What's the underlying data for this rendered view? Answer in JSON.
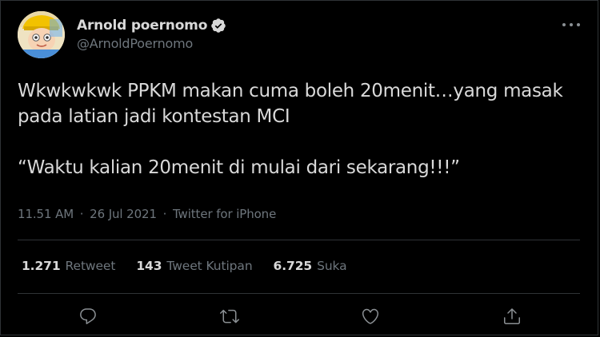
{
  "author": {
    "name": "Arnold poernomo",
    "handle": "@ArnoldPoernomo",
    "verified": true
  },
  "tweet": {
    "text_paragraph_1": "Wkwkwkwk PPKM makan cuma boleh 20menit…yang masak pada latian jadi kontestan MCI",
    "text_paragraph_2": "“Waktu kalian 20menit di mulai dari sekarang!!!”"
  },
  "meta": {
    "time": "11.51 AM",
    "separator": "·",
    "date": "26 Jul 2021",
    "source": "Twitter for iPhone"
  },
  "stats": {
    "retweets": {
      "value": "1.271",
      "label": "Retweet"
    },
    "quotes": {
      "value": "143",
      "label": "Tweet Kutipan"
    },
    "likes": {
      "value": "6.725",
      "label": "Suka"
    }
  },
  "icons": {
    "more": "more-horizontal-icon",
    "reply": "reply-icon",
    "retweet": "retweet-icon",
    "like": "heart-icon",
    "share": "share-icon",
    "verified": "verified-badge-icon"
  },
  "colors": {
    "background": "#000000",
    "text_primary": "#d9d9d9",
    "text_secondary": "#6e767d",
    "divider": "#2f3336",
    "icon": "#8b9094"
  }
}
